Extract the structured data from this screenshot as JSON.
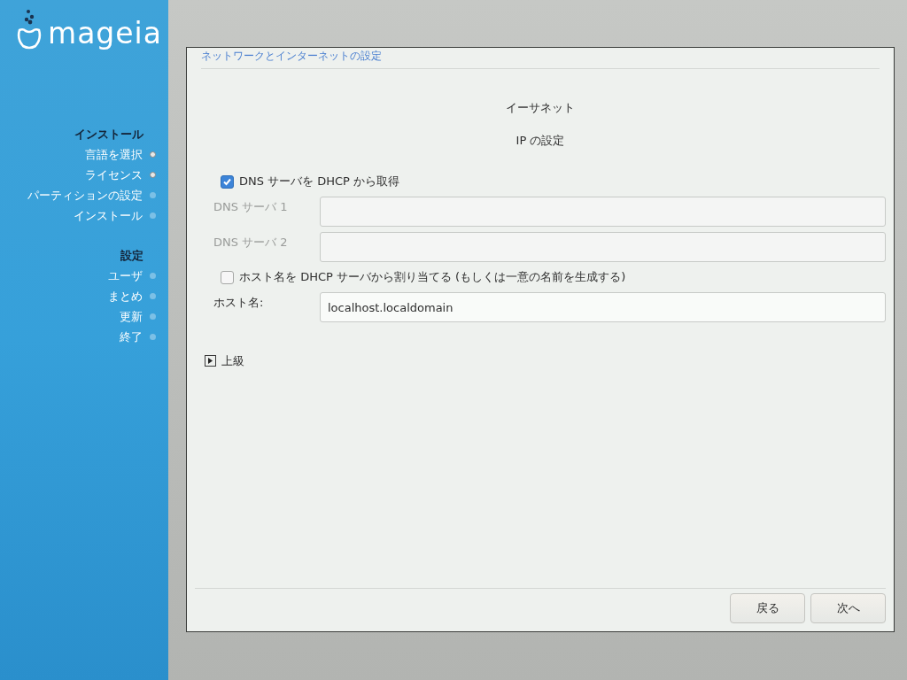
{
  "logo": {
    "text": "mageia"
  },
  "sidebar": {
    "sections": [
      {
        "title": "インストール",
        "items": [
          {
            "label": "言語を選択",
            "done": true
          },
          {
            "label": "ライセンス",
            "done": true
          },
          {
            "label": "パーティションの設定",
            "done": false
          },
          {
            "label": "インストール",
            "done": false
          }
        ]
      },
      {
        "title": "設定",
        "items": [
          {
            "label": "ユーザ",
            "done": false
          },
          {
            "label": "まとめ",
            "done": false
          },
          {
            "label": "更新",
            "done": false
          },
          {
            "label": "終了",
            "done": false
          }
        ]
      }
    ]
  },
  "dialog": {
    "title": "ネットワークとインターネットの設定",
    "heading": "イーサネット",
    "subheading": "IP の設定",
    "rows": [
      {
        "kind": "checkbox",
        "label": "DNS サーバを DHCP から取得",
        "checked": true
      },
      {
        "kind": "field",
        "label": "DNS サーバ 1",
        "disabled": true
      },
      {
        "kind": "field",
        "label": "DNS サーバ 2",
        "disabled": true
      },
      {
        "kind": "checkbox",
        "label": "ホスト名を DHCP サーバから割り当てる (もしくは一意の名前を生成する)",
        "checked": false
      },
      {
        "kind": "field",
        "label": "ホスト名:",
        "value": "localhost.localdomain",
        "disabled": false
      }
    ],
    "expander": {
      "label": "上級",
      "expanded": false
    },
    "buttons": [
      "戻る",
      "次へ"
    ]
  }
}
